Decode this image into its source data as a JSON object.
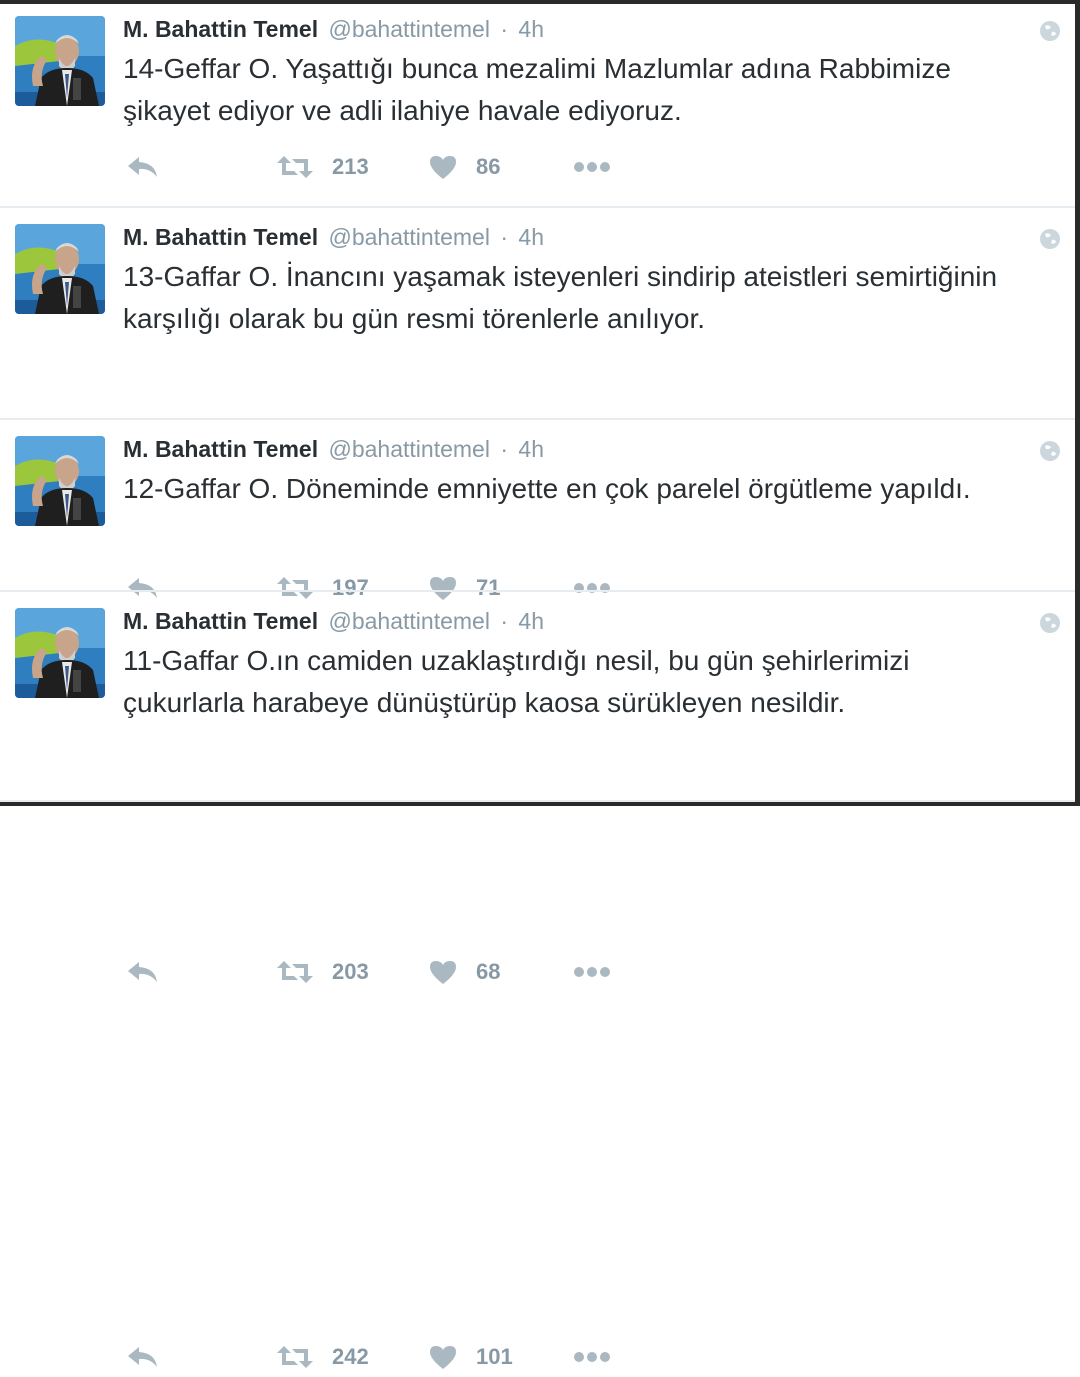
{
  "tweets": [
    {
      "name": "M. Bahattin Temel",
      "handle": "@bahattintemel",
      "separator": "·",
      "time": "4h",
      "text": "14-Geffar O. Yaşattığı bunca mezalimi Mazlumlar adına Rabbimize\nşikayet ediyor ve adli ilahiye havale ediyoruz.",
      "retweets": "213",
      "likes": "86"
    },
    {
      "name": "M. Bahattin Temel",
      "handle": "@bahattintemel",
      "separator": "·",
      "time": "4h",
      "text": "13-Gaffar O. İnancını yaşamak isteyenleri sindirip ateistleri semirtiğinin\nkarşılığı olarak bu gün resmi törenlerle anılıyor.",
      "retweets": "197",
      "likes": "71"
    },
    {
      "name": "M. Bahattin Temel",
      "handle": "@bahattintemel",
      "separator": "·",
      "time": "4h",
      "text": "12-Gaffar O. Döneminde emniyette en çok parelel örgütleme yapıldı.",
      "retweets": "203",
      "likes": "68"
    },
    {
      "name": "M. Bahattin Temel",
      "handle": "@bahattintemel",
      "separator": "·",
      "time": "4h",
      "text": "11-Gaffar O.ın camiden uzaklaştırdığı nesil, bu gün şehirlerimizi\nçukurlarla harabeye dünüştürüp kaosa sürükleyen nesildir.",
      "retweets": "242",
      "likes": "101"
    }
  ],
  "icons": {
    "reply": "reply-icon",
    "retweet": "retweet-icon",
    "like": "heart-icon",
    "more": "more-icon",
    "globe": "globe-icon"
  },
  "colors": {
    "name": "#292f33",
    "muted": "#8899a6",
    "icon": "#aab8c2",
    "divider": "#e6ecf0"
  }
}
